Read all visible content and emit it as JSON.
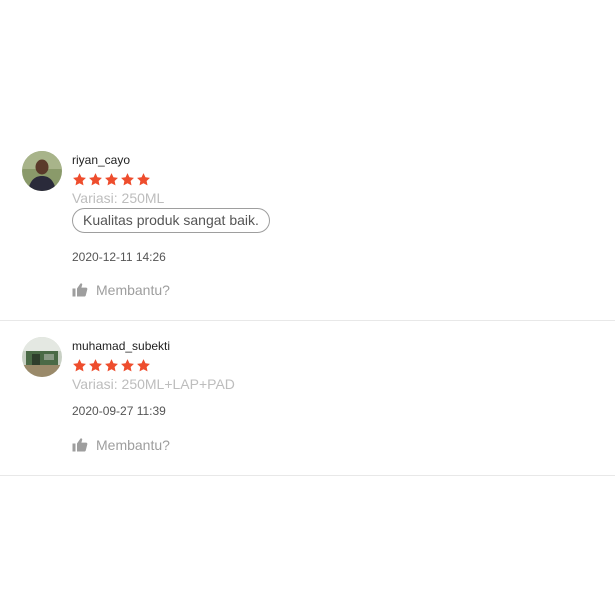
{
  "reviews": [
    {
      "author": "riyan_cayo",
      "rating": 5,
      "variant": "Variasi: 250ML",
      "tag": "Kualitas produk sangat baik.",
      "timestamp": "2020-12-11 14:26",
      "helpful_label": "Membantu?"
    },
    {
      "author": "muhamad_subekti",
      "rating": 5,
      "variant": "Variasi: 250ML+LAP+PAD",
      "timestamp": "2020-09-27 11:39",
      "helpful_label": "Membantu?"
    }
  ],
  "colors": {
    "star": "#ee4d2d",
    "divider": "#e8e8e8",
    "muted_text": "#bdbdbd"
  },
  "icons": {
    "star": "star-icon",
    "helpful": "thumbs-up-icon"
  }
}
